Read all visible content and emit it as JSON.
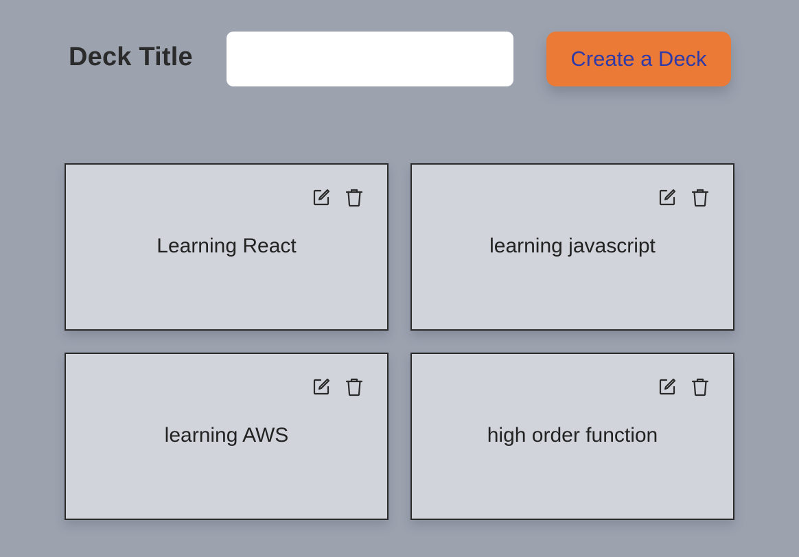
{
  "header": {
    "label": "Deck Title",
    "input_value": "",
    "input_placeholder": "",
    "create_button_label": "Create a Deck"
  },
  "decks": [
    {
      "title": "Learning React",
      "edit_icon": "edit-icon",
      "delete_icon": "trash-icon"
    },
    {
      "title": "learning javascript",
      "edit_icon": "edit-icon",
      "delete_icon": "trash-icon"
    },
    {
      "title": "learning AWS",
      "edit_icon": "edit-icon",
      "delete_icon": "trash-icon"
    },
    {
      "title": "high order function",
      "edit_icon": "edit-icon",
      "delete_icon": "trash-icon"
    }
  ],
  "colors": {
    "background": "#9ca3af",
    "card": "#d1d5db",
    "button": "#ea7a35",
    "button_text": "#2f3aa8"
  }
}
